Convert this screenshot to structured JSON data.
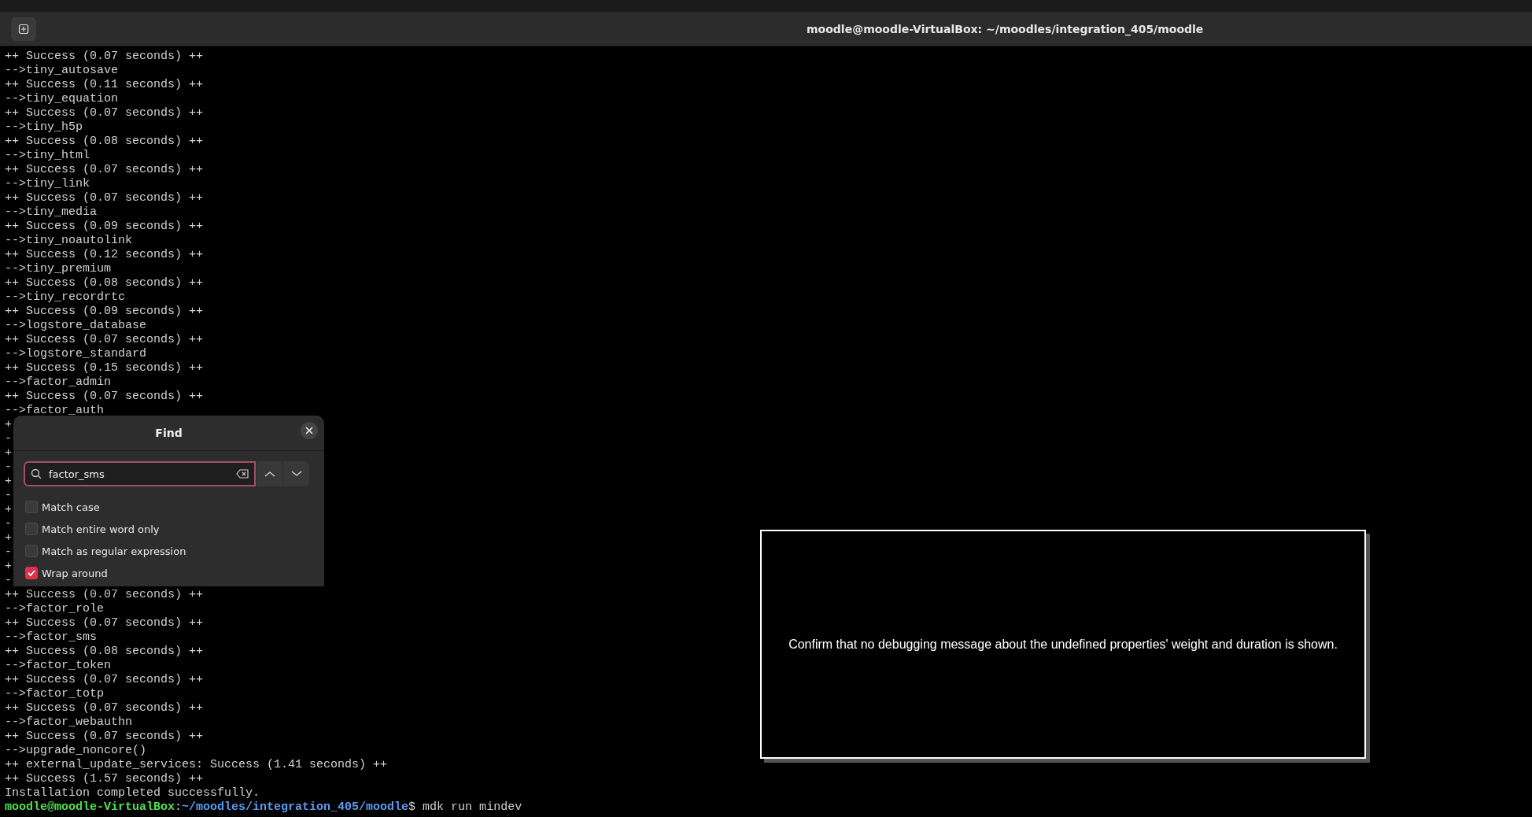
{
  "window": {
    "title": "moodle@moodle-VirtualBox: ~/moodles/integration_405/moodle"
  },
  "terminal": {
    "lines": [
      {
        "kind": "output",
        "text": "++ Success (0.07 seconds) ++"
      },
      {
        "kind": "output",
        "text": "-->tiny_autosave"
      },
      {
        "kind": "output",
        "text": "++ Success (0.11 seconds) ++"
      },
      {
        "kind": "output",
        "text": "-->tiny_equation"
      },
      {
        "kind": "output",
        "text": "++ Success (0.07 seconds) ++"
      },
      {
        "kind": "output",
        "text": "-->tiny_h5p"
      },
      {
        "kind": "output",
        "text": "++ Success (0.08 seconds) ++"
      },
      {
        "kind": "output",
        "text": "-->tiny_html"
      },
      {
        "kind": "output",
        "text": "++ Success (0.07 seconds) ++"
      },
      {
        "kind": "output",
        "text": "-->tiny_link"
      },
      {
        "kind": "output",
        "text": "++ Success (0.07 seconds) ++"
      },
      {
        "kind": "output",
        "text": "-->tiny_media"
      },
      {
        "kind": "output",
        "text": "++ Success (0.09 seconds) ++"
      },
      {
        "kind": "output",
        "text": "-->tiny_noautolink"
      },
      {
        "kind": "output",
        "text": "++ Success (0.12 seconds) ++"
      },
      {
        "kind": "output",
        "text": "-->tiny_premium"
      },
      {
        "kind": "output",
        "text": "++ Success (0.08 seconds) ++"
      },
      {
        "kind": "output",
        "text": "-->tiny_recordrtc"
      },
      {
        "kind": "output",
        "text": "++ Success (0.09 seconds) ++"
      },
      {
        "kind": "output",
        "text": "-->logstore_database"
      },
      {
        "kind": "output",
        "text": "++ Success (0.07 seconds) ++"
      },
      {
        "kind": "output",
        "text": "-->logstore_standard"
      },
      {
        "kind": "output",
        "text": "++ Success (0.15 seconds) ++"
      },
      {
        "kind": "output",
        "text": "-->factor_admin"
      },
      {
        "kind": "output",
        "text": "++ Success (0.07 seconds) ++"
      },
      {
        "kind": "output",
        "text": "-->factor_auth"
      },
      {
        "kind": "output",
        "text": "+"
      },
      {
        "kind": "output",
        "text": "-"
      },
      {
        "kind": "output",
        "text": "+"
      },
      {
        "kind": "output",
        "text": "-"
      },
      {
        "kind": "output",
        "text": "+"
      },
      {
        "kind": "output",
        "text": "-"
      },
      {
        "kind": "output",
        "text": "+"
      },
      {
        "kind": "output",
        "text": "-"
      },
      {
        "kind": "output",
        "text": "+"
      },
      {
        "kind": "output",
        "text": "-"
      },
      {
        "kind": "output",
        "text": "+"
      },
      {
        "kind": "output",
        "text": "-"
      },
      {
        "kind": "output",
        "text": "++ Success (0.07 seconds) ++"
      },
      {
        "kind": "output",
        "text": "-->factor_role"
      },
      {
        "kind": "output",
        "text": "++ Success (0.07 seconds) ++"
      },
      {
        "kind": "output",
        "text": "-->factor_sms"
      },
      {
        "kind": "output",
        "text": "++ Success (0.08 seconds) ++"
      },
      {
        "kind": "output",
        "text": "-->factor_token"
      },
      {
        "kind": "output",
        "text": "++ Success (0.07 seconds) ++"
      },
      {
        "kind": "output",
        "text": "-->factor_totp"
      },
      {
        "kind": "output",
        "text": "++ Success (0.07 seconds) ++"
      },
      {
        "kind": "output",
        "text": "-->factor_webauthn"
      },
      {
        "kind": "output",
        "text": "++ Success (0.07 seconds) ++"
      },
      {
        "kind": "output",
        "text": "-->upgrade_noncore()"
      },
      {
        "kind": "output",
        "text": "++ external_update_services: Success (1.41 seconds) ++"
      },
      {
        "kind": "output",
        "text": "++ Success (1.57 seconds) ++"
      },
      {
        "kind": "output",
        "text": "Installation completed successfully."
      },
      {
        "kind": "prompt",
        "user": "moodle@moodle-VirtualBox",
        "separator": ":",
        "path": "~/moodles/integration_405/moodle",
        "command": "$ mdk run mindev"
      }
    ]
  },
  "find_dialog": {
    "title": "Find",
    "search": {
      "value": "factor_sms"
    },
    "options": [
      {
        "label": "Match case",
        "checked": false
      },
      {
        "label": "Match entire word only",
        "checked": false
      },
      {
        "label": "Match as regular expression",
        "checked": false
      },
      {
        "label": "Wrap around",
        "checked": true
      }
    ]
  },
  "instruction": {
    "text": "Confirm that no debugging message about the undefined properties' weight and duration is shown."
  }
}
